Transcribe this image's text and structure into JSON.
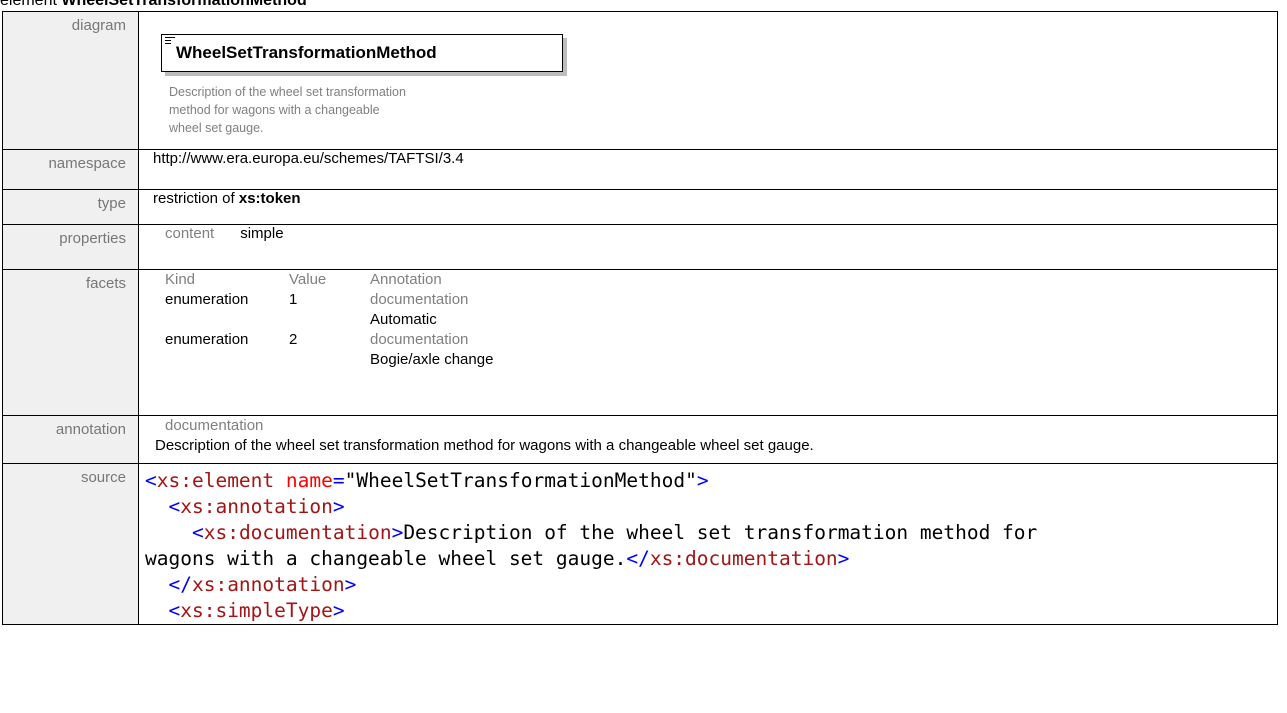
{
  "header": {
    "prefix": "element",
    "name": "WheelSetTransformationMethod"
  },
  "rows": {
    "diagram": {
      "label": "diagram",
      "element_name": "WheelSetTransformationMethod",
      "description_lines": [
        "Description of the wheel set transformation",
        "method for wagons with a changeable",
        "wheel set gauge."
      ]
    },
    "namespace": {
      "label": "namespace",
      "value": "http://www.era.europa.eu/schemes/TAFTSI/3.4"
    },
    "type": {
      "label": "type",
      "prefix": "restriction of",
      "base": "xs:token"
    },
    "properties": {
      "label": "properties",
      "key": "content",
      "value": "simple"
    },
    "facets": {
      "label": "facets",
      "headers": [
        "Kind",
        "Value",
        "Annotation"
      ],
      "items": [
        {
          "kind": "enumeration",
          "value": "1",
          "doc_label": "documentation",
          "doc_text": "Automatic"
        },
        {
          "kind": "enumeration",
          "value": "2",
          "doc_label": "documentation",
          "doc_text": "Bogie/axle change"
        }
      ]
    },
    "annotation": {
      "label": "annotation",
      "key": "documentation",
      "text": "Description of the wheel set transformation method for wagons with a changeable wheel set gauge."
    },
    "source": {
      "label": "source",
      "lines": {
        "l1_tag": "xs:element",
        "l1_attr": "name",
        "l1_val": "\"WheelSetTransformationMethod\"",
        "l2_tag": "xs:annotation",
        "l3_tag": "xs:documentation",
        "l3_text": "Description of the wheel set transformation method for",
        "l4_text": "wagons with a changeable wheel set gauge.",
        "l4_endtag": "xs:documentation",
        "l5_endtag": "xs:annotation",
        "l6_tag": "xs:simpleType"
      }
    }
  }
}
